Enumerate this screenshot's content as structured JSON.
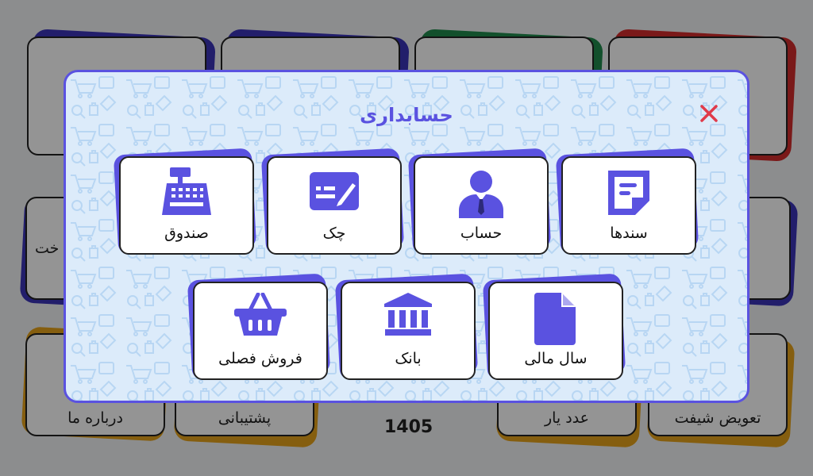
{
  "background": {
    "tiles": [
      {
        "label": ""
      },
      {
        "label": ""
      },
      {
        "label": ""
      },
      {
        "label": ""
      },
      {
        "label": "خت"
      },
      {
        "label": "درباره ما"
      },
      {
        "label": "پشتیبانی"
      },
      {
        "label": "عدد یار"
      },
      {
        "label": "تعویض شیفت"
      }
    ],
    "year_text": "1405",
    "accent_colors": [
      "#3b35b8",
      "#3b35b8",
      "#1f8a4c",
      "#d22c2c",
      "#e6a21a"
    ]
  },
  "dialog": {
    "title": "حسابداری",
    "close_icon": "close-icon",
    "accent_color": "#5a52e0",
    "tiles": [
      {
        "label": "سندها",
        "icon": "document-icon"
      },
      {
        "label": "حساب",
        "icon": "user-icon"
      },
      {
        "label": "چک",
        "icon": "cheque-icon"
      },
      {
        "label": "صندوق",
        "icon": "cash-register-icon"
      },
      {
        "label": "سال مالی",
        "icon": "file-icon"
      },
      {
        "label": "بانک",
        "icon": "bank-icon"
      },
      {
        "label": "فروش فصلی",
        "icon": "basket-icon"
      }
    ]
  }
}
